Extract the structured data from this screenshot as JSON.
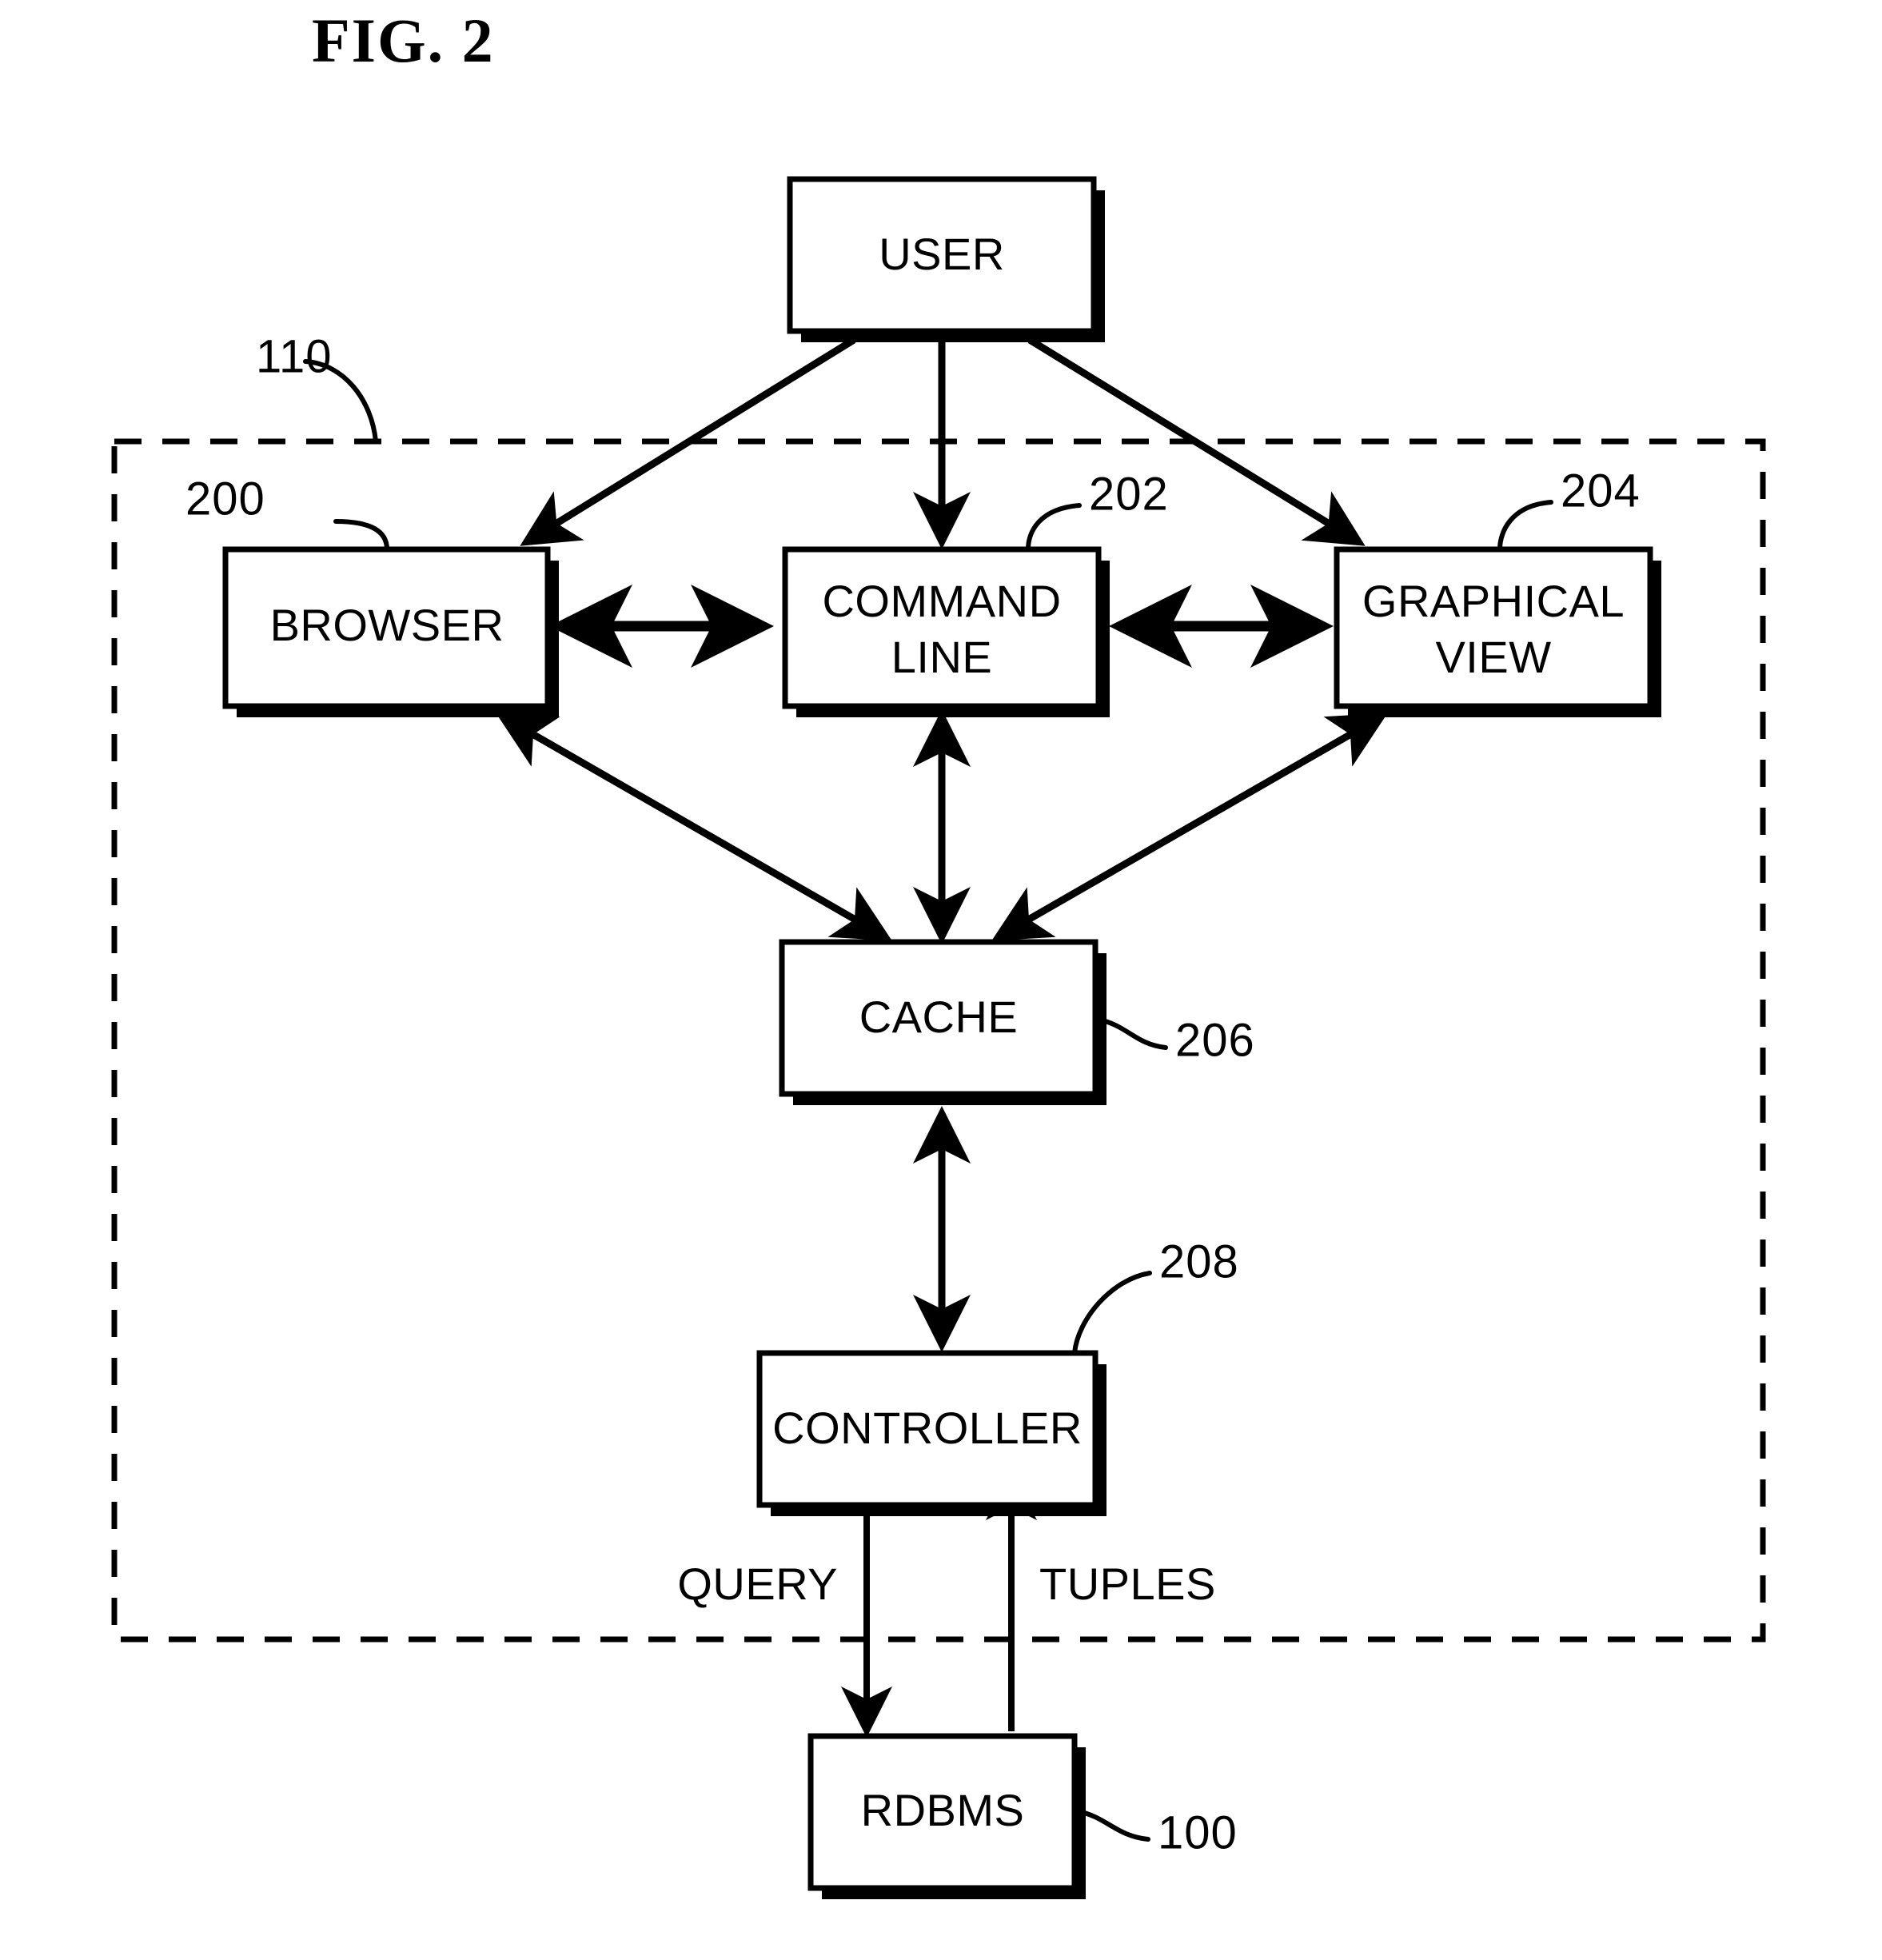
{
  "figure": {
    "title": "FIG. 2",
    "type": "patent-block-diagram"
  },
  "boundary": {
    "name": "system-boundary",
    "reference_number": "110",
    "style": "dashed"
  },
  "nodes": [
    {
      "id": "user",
      "label": "USER",
      "reference_number": ""
    },
    {
      "id": "browser",
      "label": "BROWSER",
      "reference_number": "200"
    },
    {
      "id": "command_line",
      "label_line1": "COMMAND",
      "label_line2": "LINE",
      "reference_number": "202"
    },
    {
      "id": "graphical_view",
      "label_line1": "GRAPHICAL",
      "label_line2": "VIEW",
      "reference_number": "204"
    },
    {
      "id": "cache",
      "label": "CACHE",
      "reference_number": "206"
    },
    {
      "id": "controller",
      "label": "CONTROLLER",
      "reference_number": "208"
    },
    {
      "id": "rdbms",
      "label": "RDBMS",
      "reference_number": "100"
    }
  ],
  "edges": [
    {
      "from": "user",
      "to": "browser",
      "label": "",
      "direction": "one-way"
    },
    {
      "from": "user",
      "to": "command_line",
      "label": "",
      "direction": "one-way"
    },
    {
      "from": "user",
      "to": "graphical_view",
      "label": "",
      "direction": "one-way"
    },
    {
      "from": "browser",
      "to": "command_line",
      "label": "",
      "direction": "two-way"
    },
    {
      "from": "command_line",
      "to": "graphical_view",
      "label": "",
      "direction": "two-way"
    },
    {
      "from": "browser",
      "to": "cache",
      "label": "",
      "direction": "two-way"
    },
    {
      "from": "command_line",
      "to": "cache",
      "label": "",
      "direction": "two-way"
    },
    {
      "from": "graphical_view",
      "to": "cache",
      "label": "",
      "direction": "two-way"
    },
    {
      "from": "cache",
      "to": "controller",
      "label": "",
      "direction": "two-way"
    },
    {
      "from": "controller",
      "to": "rdbms",
      "label": "QUERY",
      "direction": "one-way"
    },
    {
      "from": "rdbms",
      "to": "controller",
      "label": "TUPLES",
      "direction": "one-way"
    }
  ],
  "labels": {
    "title": "FIG. 2",
    "user": "USER",
    "browser": "BROWSER",
    "command_line_1": "COMMAND",
    "command_line_2": "LINE",
    "graphical_view_1": "GRAPHICAL",
    "graphical_view_2": "VIEW",
    "cache": "CACHE",
    "controller": "CONTROLLER",
    "rdbms": "RDBMS",
    "query": "QUERY",
    "tuples": "TUPLES",
    "ref_110": "110",
    "ref_200": "200",
    "ref_202": "202",
    "ref_204": "204",
    "ref_206": "206",
    "ref_208": "208",
    "ref_100": "100"
  },
  "colors": {
    "ink": "#000000",
    "paper": "#ffffff"
  }
}
